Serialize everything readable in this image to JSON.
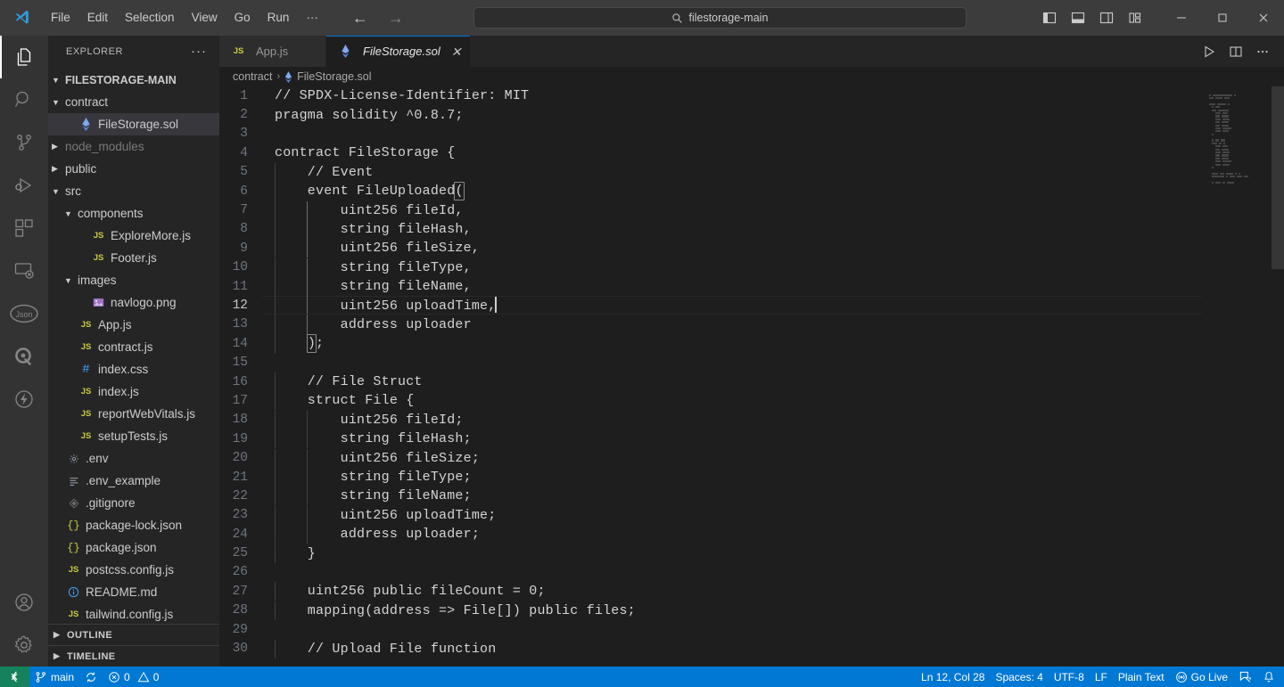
{
  "titlebar": {
    "logo": "vscode-logo",
    "menus": [
      "File",
      "Edit",
      "Selection",
      "View",
      "Go",
      "Run",
      "···"
    ],
    "nav_back": "back-arrow",
    "nav_forward": "forward-arrow",
    "command_center": {
      "icon": "search-icon",
      "text": "filestorage-main"
    },
    "layout_buttons": [
      {
        "name": "toggle-primary-sidebar",
        "icon": "layout-sidebar-left-icon"
      },
      {
        "name": "toggle-panel",
        "icon": "layout-panel-bottom-icon"
      },
      {
        "name": "toggle-secondary-sidebar",
        "icon": "layout-sidebar-right-icon"
      },
      {
        "name": "customize-layout",
        "icon": "layout-customize-icon"
      }
    ],
    "window_controls": [
      {
        "name": "minimize-window-button",
        "icon": "minimize-icon"
      },
      {
        "name": "maximize-window-button",
        "icon": "maximize-icon"
      },
      {
        "name": "close-window-button",
        "icon": "close-icon"
      }
    ]
  },
  "activitybar": {
    "items": [
      {
        "name": "activity-explorer",
        "icon": "files-icon",
        "active": true
      },
      {
        "name": "activity-search",
        "icon": "search-icon",
        "active": false
      },
      {
        "name": "activity-source-control",
        "icon": "source-control-icon",
        "active": false
      },
      {
        "name": "activity-run-debug",
        "icon": "run-and-debug-icon",
        "active": false
      },
      {
        "name": "activity-extensions",
        "icon": "extensions-icon",
        "active": false
      },
      {
        "name": "activity-remote-explorer",
        "icon": "remote-explorer-icon",
        "active": false
      },
      {
        "name": "activity-json-viewer",
        "icon": "json-icon",
        "active": false
      },
      {
        "name": "activity-amazon-q",
        "icon": "amazon-q-icon",
        "active": false
      },
      {
        "name": "activity-thunder-client",
        "icon": "thunder-client-icon",
        "active": false
      }
    ],
    "bottom": [
      {
        "name": "activity-accounts",
        "icon": "account-icon"
      },
      {
        "name": "activity-settings",
        "icon": "gear-icon"
      }
    ]
  },
  "sidebar": {
    "title": "EXPLORER",
    "more_actions": "···",
    "root": {
      "label": "FILESTORAGE-MAIN",
      "expanded": true
    },
    "tree": [
      {
        "label": "contract",
        "indent": 1,
        "type": "folder",
        "expanded": true,
        "icon": "chevron-down-icon"
      },
      {
        "label": "FileStorage.sol",
        "indent": 2,
        "type": "file",
        "icon": "solidity-icon",
        "selected": true
      },
      {
        "label": "node_modules",
        "indent": 1,
        "type": "folder",
        "expanded": false,
        "icon": "chevron-right-icon",
        "dimmed": true
      },
      {
        "label": "public",
        "indent": 1,
        "type": "folder",
        "expanded": false,
        "icon": "chevron-right-icon"
      },
      {
        "label": "src",
        "indent": 1,
        "type": "folder",
        "expanded": true,
        "icon": "chevron-down-icon"
      },
      {
        "label": "components",
        "indent": 2,
        "type": "folder",
        "expanded": true,
        "icon": "chevron-down-icon"
      },
      {
        "label": "ExploreMore.js",
        "indent": 3,
        "type": "file",
        "icon": "js-icon"
      },
      {
        "label": "Footer.js",
        "indent": 3,
        "type": "file",
        "icon": "js-icon"
      },
      {
        "label": "images",
        "indent": 2,
        "type": "folder",
        "expanded": true,
        "icon": "chevron-down-icon"
      },
      {
        "label": "navlogo.png",
        "indent": 3,
        "type": "file",
        "icon": "image-icon"
      },
      {
        "label": "App.js",
        "indent": 2,
        "type": "file",
        "icon": "js-icon"
      },
      {
        "label": "contract.js",
        "indent": 2,
        "type": "file",
        "icon": "js-icon"
      },
      {
        "label": "index.css",
        "indent": 2,
        "type": "file",
        "icon": "css-icon"
      },
      {
        "label": "index.js",
        "indent": 2,
        "type": "file",
        "icon": "js-icon"
      },
      {
        "label": "reportWebVitals.js",
        "indent": 2,
        "type": "file",
        "icon": "js-icon"
      },
      {
        "label": "setupTests.js",
        "indent": 2,
        "type": "file",
        "icon": "js-icon"
      },
      {
        "label": ".env",
        "indent": 1,
        "type": "file",
        "icon": "gear-icon"
      },
      {
        "label": ".env_example",
        "indent": 1,
        "type": "file",
        "icon": "settings-list-icon"
      },
      {
        "label": ".gitignore",
        "indent": 1,
        "type": "file",
        "icon": "git-icon"
      },
      {
        "label": "package-lock.json",
        "indent": 1,
        "type": "file",
        "icon": "json-braces-icon"
      },
      {
        "label": "package.json",
        "indent": 1,
        "type": "file",
        "icon": "json-braces-icon"
      },
      {
        "label": "postcss.config.js",
        "indent": 1,
        "type": "file",
        "icon": "js-icon"
      },
      {
        "label": "README.md",
        "indent": 1,
        "type": "file",
        "icon": "info-icon"
      },
      {
        "label": "tailwind.config.js",
        "indent": 1,
        "type": "file",
        "icon": "js-icon"
      }
    ],
    "sections": [
      {
        "label": "OUTLINE",
        "icon": "chevron-right-icon"
      },
      {
        "label": "TIMELINE",
        "icon": "chevron-right-icon"
      }
    ]
  },
  "editor": {
    "tabs": [
      {
        "label": "App.js",
        "icon": "js-icon",
        "active": false,
        "closable": false
      },
      {
        "label": "FileStorage.sol",
        "icon": "solidity-icon",
        "active": true,
        "closable": true,
        "close_icon": "close-icon",
        "preview": true
      }
    ],
    "actions": [
      {
        "name": "run-code-button",
        "icon": "play-icon"
      },
      {
        "name": "split-editor-button",
        "icon": "split-editor-icon"
      },
      {
        "name": "more-actions-button",
        "icon": "ellipsis-icon"
      }
    ],
    "breadcrumb": [
      {
        "label": "contract",
        "icon": null
      },
      {
        "label": "FileStorage.sol",
        "icon": "solidity-icon"
      }
    ],
    "breadcrumb_separator": "›",
    "code": [
      {
        "n": 1,
        "text": "// SPDX-License-Identifier: MIT"
      },
      {
        "n": 2,
        "text": "pragma solidity ^0.8.7;"
      },
      {
        "n": 3,
        "text": ""
      },
      {
        "n": 4,
        "text": "contract FileStorage {"
      },
      {
        "n": 5,
        "text": "    // Event"
      },
      {
        "n": 6,
        "text": "    event FileUploaded("
      },
      {
        "n": 7,
        "text": "        uint256 fileId,"
      },
      {
        "n": 8,
        "text": "        string fileHash,"
      },
      {
        "n": 9,
        "text": "        uint256 fileSize,"
      },
      {
        "n": 10,
        "text": "        string fileType,"
      },
      {
        "n": 11,
        "text": "        string fileName,"
      },
      {
        "n": 12,
        "text": "        uint256 uploadTime,",
        "active": true,
        "cursor": true
      },
      {
        "n": 13,
        "text": "        address uploader"
      },
      {
        "n": 14,
        "text": "    );"
      },
      {
        "n": 15,
        "text": ""
      },
      {
        "n": 16,
        "text": "    // File Struct"
      },
      {
        "n": 17,
        "text": "    struct File {"
      },
      {
        "n": 18,
        "text": "        uint256 fileId;"
      },
      {
        "n": 19,
        "text": "        string fileHash;"
      },
      {
        "n": 20,
        "text": "        uint256 fileSize;"
      },
      {
        "n": 21,
        "text": "        string fileType;"
      },
      {
        "n": 22,
        "text": "        string fileName;"
      },
      {
        "n": 23,
        "text": "        uint256 uploadTime;"
      },
      {
        "n": 24,
        "text": "        address uploader;"
      },
      {
        "n": 25,
        "text": "    }"
      },
      {
        "n": 26,
        "text": ""
      },
      {
        "n": 27,
        "text": "    uint256 public fileCount = 0;"
      },
      {
        "n": 28,
        "text": "    mapping(address => File[]) public files;"
      },
      {
        "n": 29,
        "text": ""
      },
      {
        "n": 30,
        "text": "    // Upload File function"
      }
    ]
  },
  "statusbar": {
    "remote_icon": "remote-window-icon",
    "left": [
      {
        "name": "status-branch",
        "icon": "source-control-icon",
        "label": "main"
      },
      {
        "name": "status-sync",
        "icon": "sync-icon",
        "label": ""
      },
      {
        "name": "status-problems",
        "icon": "error-warning-icon",
        "label": "0 ⚠ 0",
        "errors": "0",
        "warnings": "0"
      }
    ],
    "right": [
      {
        "name": "status-cursor-position",
        "label": "Ln 12, Col 28"
      },
      {
        "name": "status-indentation",
        "label": "Spaces: 4"
      },
      {
        "name": "status-encoding",
        "label": "UTF-8"
      },
      {
        "name": "status-eol",
        "label": "LF"
      },
      {
        "name": "status-language-mode",
        "label": "Plain Text"
      },
      {
        "name": "status-go-live",
        "label": "Go Live",
        "icon": "broadcast-icon"
      },
      {
        "name": "status-feedback",
        "label": "",
        "icon": "feedback-icon"
      },
      {
        "name": "status-notifications",
        "label": "",
        "icon": "bell-icon"
      }
    ]
  },
  "colors": {
    "accent": "#0078d4",
    "remote_green": "#16825d",
    "editor_bg": "#1e1e1e",
    "sidebar_bg": "#252526",
    "activitybar_bg": "#333333",
    "titlebar_bg": "#3c3c3c",
    "code_fg": "#d4d4d4",
    "line_number": "#6e7681"
  }
}
